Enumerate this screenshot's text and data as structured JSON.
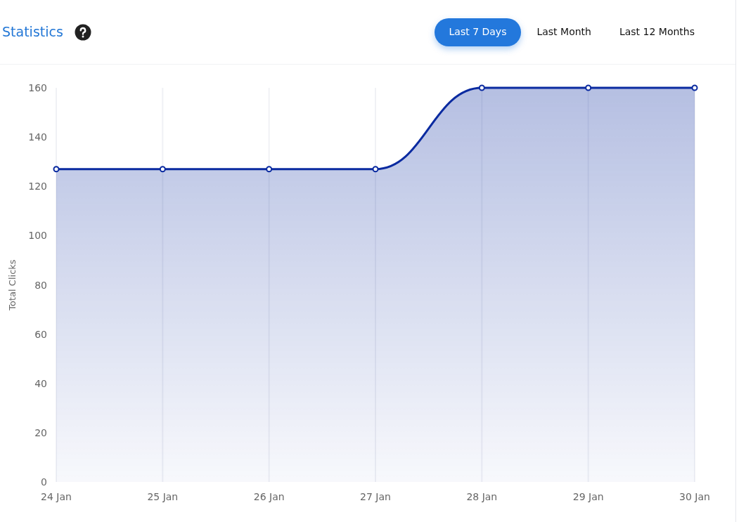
{
  "header": {
    "title": "Statistics",
    "ranges": [
      {
        "label": "Last 7 Days",
        "selected": true
      },
      {
        "label": "Last Month",
        "selected": false
      },
      {
        "label": "Last 12 Months",
        "selected": false
      }
    ]
  },
  "chart_data": {
    "type": "area",
    "ylabel": "Total Clicks",
    "categories": [
      "24 Jan",
      "25 Jan",
      "26 Jan",
      "27 Jan",
      "28 Jan",
      "29 Jan",
      "30 Jan"
    ],
    "series": [
      {
        "color": "#0a2aa0",
        "values": [
          127,
          127,
          127,
          127,
          160,
          160,
          160
        ]
      }
    ],
    "grid": true,
    "ylim": [
      0,
      160
    ],
    "yticks": [
      0,
      20,
      40,
      60,
      80,
      100,
      120,
      140,
      160
    ]
  }
}
